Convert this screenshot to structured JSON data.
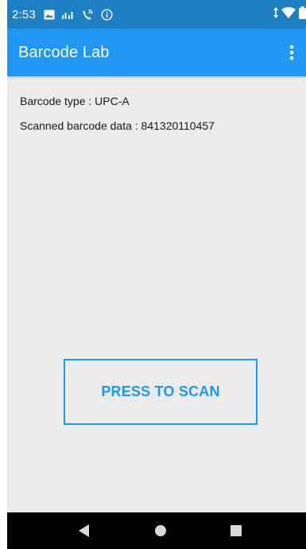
{
  "status_bar": {
    "time": "2:53",
    "icons": [
      "image-icon",
      "signal-bars-icon",
      "wifi-calling-icon",
      "info-icon"
    ],
    "right_icons": [
      "data-arrows-icon",
      "wifi-icon",
      "battery-icon"
    ]
  },
  "app_bar": {
    "title": "Barcode Lab",
    "overflow_icon": "more-vert-icon"
  },
  "content": {
    "barcode_type": "Barcode type : UPC-A",
    "scanned_data": "Scanned barcode data : 841320110457"
  },
  "scan_button": {
    "label": "PRESS TO SCAN"
  },
  "nav_bar": {
    "icons": [
      "back-icon",
      "home-icon",
      "recents-icon"
    ]
  },
  "colors": {
    "status_bar": "#1f7fc4",
    "app_bar": "#2196f3",
    "accent": "#2196f3",
    "background": "#ececec",
    "nav_bar": "#000000"
  }
}
